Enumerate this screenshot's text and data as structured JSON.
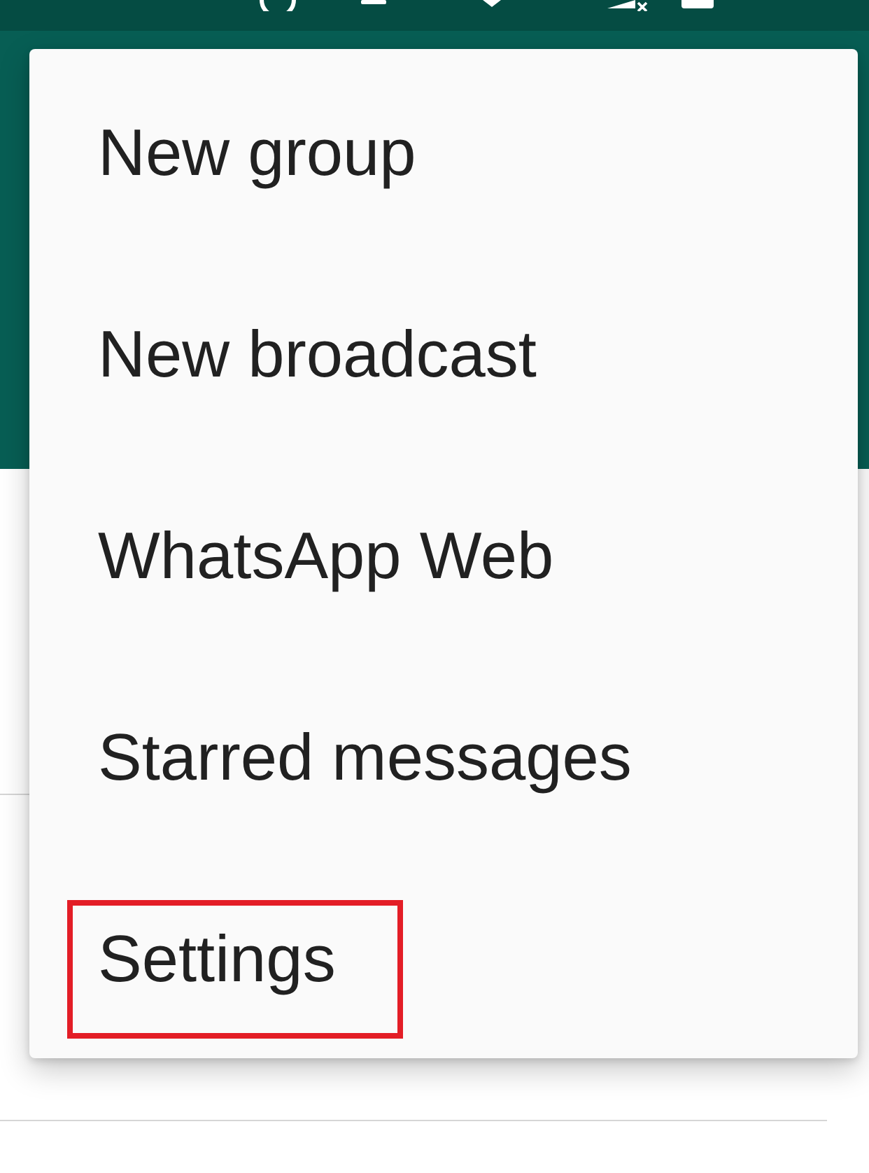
{
  "menu": {
    "items": [
      {
        "label": "New group",
        "highlighted": false
      },
      {
        "label": "New broadcast",
        "highlighted": false
      },
      {
        "label": "WhatsApp Web",
        "highlighted": false
      },
      {
        "label": "Starred messages",
        "highlighted": false
      },
      {
        "label": "Settings",
        "highlighted": true
      }
    ]
  }
}
